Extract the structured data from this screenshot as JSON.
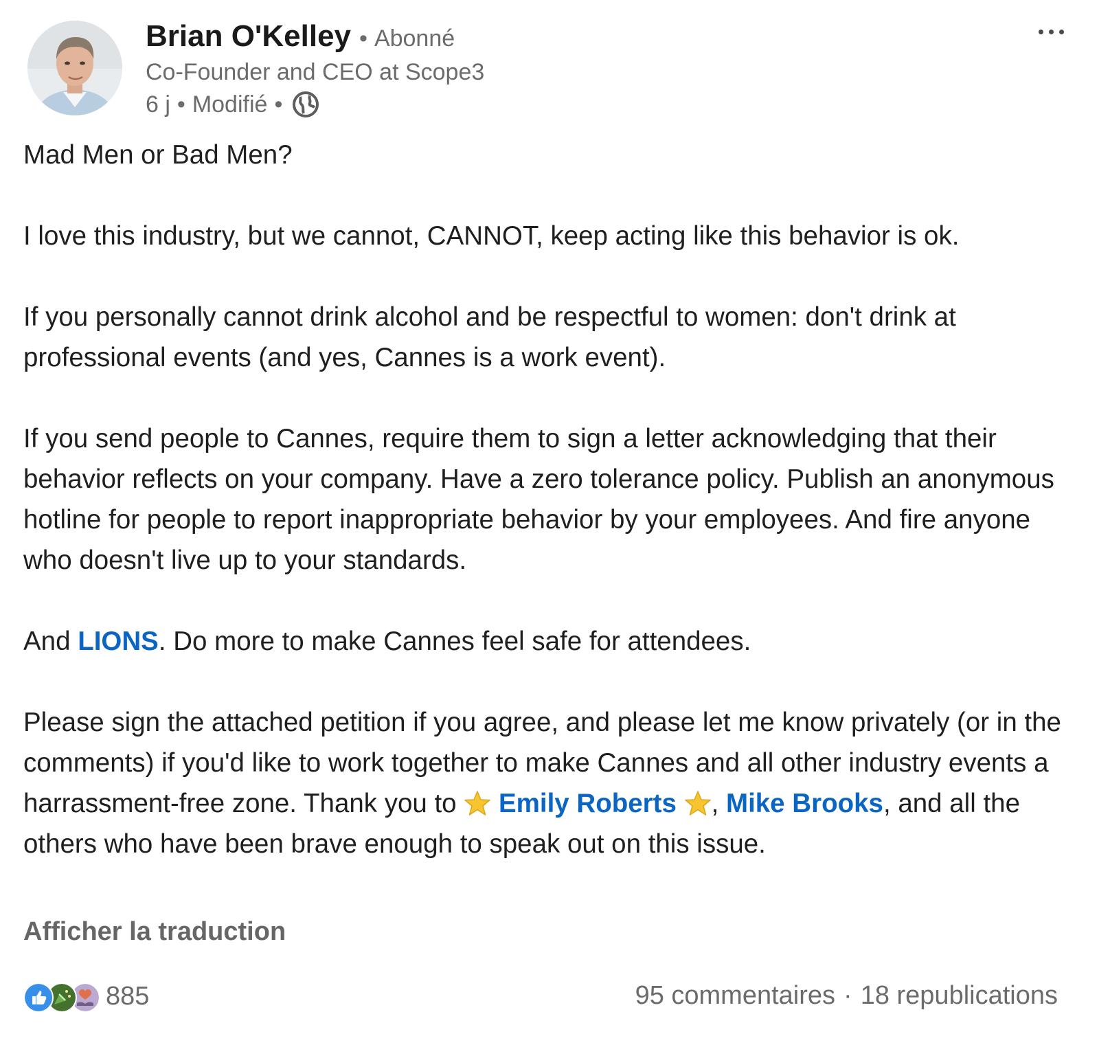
{
  "author": {
    "name": "Brian O'Kelley",
    "separator": "•",
    "follow_state": "Abonné",
    "headline": "Co-Founder and CEO at Scope3",
    "time": "6 j",
    "edited": "Modifié",
    "visibility_icon": "globe-icon"
  },
  "actions": {
    "more_icon": "more-options-icon"
  },
  "post": {
    "p1": "Mad Men or Bad Men?",
    "p2": "I love this industry, but we cannot, CANNOT, keep acting like this behavior is ok.",
    "p3": "If you personally cannot drink alcohol and be respectful to women: don't drink at professional events (and yes, Cannes is a work event).",
    "p4": "If you send people to Cannes, require them to sign a letter acknowledging that their behavior reflects on your company. Have a zero tolerance policy. Publish an anonymous hotline for people to report inappropriate behavior by your employees. And fire anyone who doesn't live up to your standards.",
    "p5_before": "And ",
    "p5_mention": "LIONS",
    "p5_after": ". Do more to make Cannes feel safe for attendees.",
    "p6_before": "Please sign the attached petition if you agree, and please let me know privately (or in the comments) if you'd like to work together to make Cannes and all other industry events a harrassment-free zone. Thank you to ",
    "p6_mention1": "Emily Roberts",
    "p6_comma": ", ",
    "p6_mention2": "Mike Brooks",
    "p6_after": ", and all the others who have been brave enough to speak out on this issue."
  },
  "translate_label": "Afficher la traduction",
  "social": {
    "reaction_icons": [
      "like-icon",
      "celebrate-icon",
      "support-icon"
    ],
    "reaction_count": "885",
    "comments": "95 commentaires",
    "dot": "·",
    "reposts": "18 republications"
  },
  "colors": {
    "link": "#0a66c2",
    "secondary_text": "#6b6b6b",
    "primary_text": "#1f1f1f"
  }
}
